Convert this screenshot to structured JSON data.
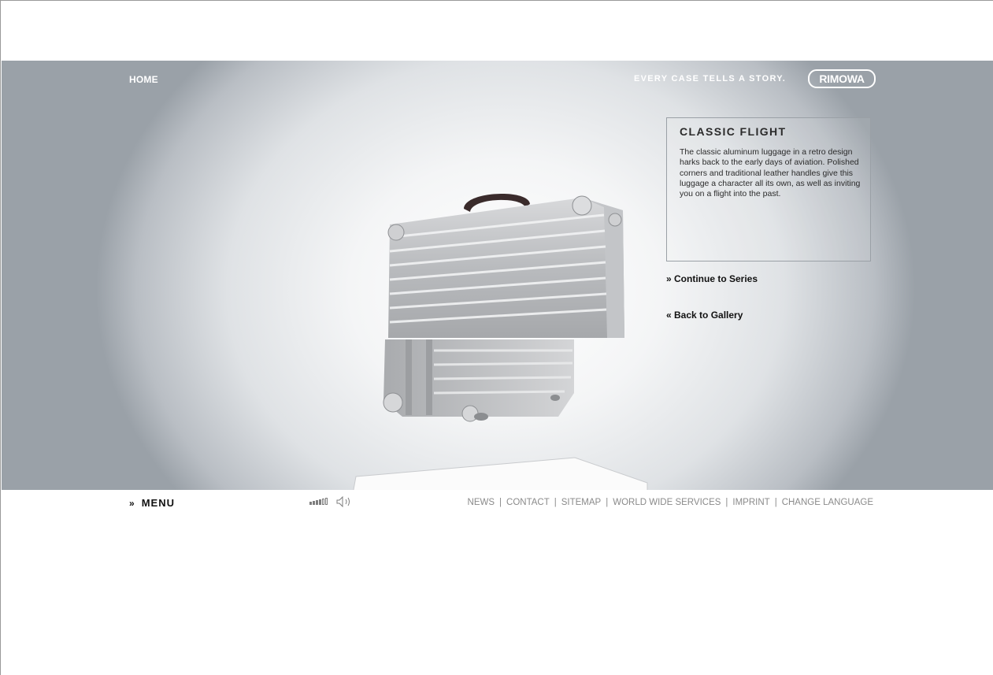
{
  "header": {
    "home_label": "HOME",
    "tagline": "EVERY CASE TELLS A STORY.",
    "logo_text": "RIMOWA"
  },
  "product": {
    "title": "CLASSIC FLIGHT",
    "description": "The classic aluminum luggage in a retro design harks back to the early days of aviation. Polished corners and traditional leather handles give this luggage a character all its own, as well as inviting you on a flight into the past."
  },
  "links": {
    "continue_series": "» Continue to Series",
    "back_gallery": "« Back to Gallery"
  },
  "footer": {
    "menu_arrow": "»",
    "menu_label": "MENU",
    "volume_level": 0.67,
    "links": [
      "NEWS",
      "CONTACT",
      "SITEMAP",
      "WORLD WIDE SERVICES",
      "IMPRINT",
      "CHANGE LANGUAGE"
    ]
  },
  "colors": {
    "stage_center": "#ffffff",
    "stage_edge": "#9aa1a8",
    "text_dark": "#111111",
    "footer_link": "#8a8a8a"
  },
  "icons": {
    "volume": "volume-bars-icon",
    "speaker": "speaker-icon"
  }
}
